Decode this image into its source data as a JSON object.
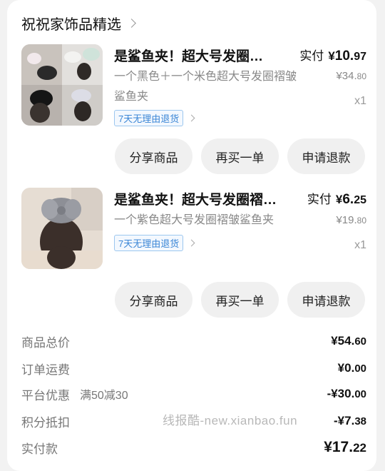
{
  "shop": {
    "name": "祝祝家饰品精选"
  },
  "items": [
    {
      "title": "是鲨鱼夹！超大号发圈…",
      "pay_label": "实付",
      "pay_yen": "¥",
      "pay_int": "10.",
      "pay_dec": "97",
      "spec": "一个黑色＋一个米色超大号发圈褶皱鲨鱼夹",
      "orig_int": "¥34.",
      "orig_dec": "80",
      "qty": "x1",
      "return_tag": "7天无理由退货"
    },
    {
      "title": "是鲨鱼夹！超大号发圈褶…",
      "pay_label": "实付",
      "pay_yen": "¥",
      "pay_int": "6.",
      "pay_dec": "25",
      "spec": "一个紫色超大号发圈褶皱鲨鱼夹",
      "orig_int": "¥19.",
      "orig_dec": "80",
      "qty": "x1",
      "return_tag": "7天无理由退货"
    }
  ],
  "buttons": {
    "share": "分享商品",
    "rebuy": "再买一单",
    "refund": "申请退款"
  },
  "summary": {
    "goods_total_label": "商品总价",
    "goods_total_int": "¥54.",
    "goods_total_dec": "60",
    "shipping_label": "订单运费",
    "shipping_int": "¥0.",
    "shipping_dec": "00",
    "discount_label": "平台优惠",
    "discount_note": "满50减30",
    "discount_int": "-¥30.",
    "discount_dec": "00",
    "points_label": "积分抵扣",
    "points_int": "-¥7.",
    "points_dec": "38",
    "paid_label": "实付款",
    "paid_int": "¥17.",
    "paid_dec": "22"
  },
  "watermark": "线报酷-new.xianbao.fun",
  "colors": {
    "tag_blue": "#3b86d6",
    "button_bg": "#f0f0f0"
  },
  "icons": [
    "chevron-right-icon"
  ]
}
